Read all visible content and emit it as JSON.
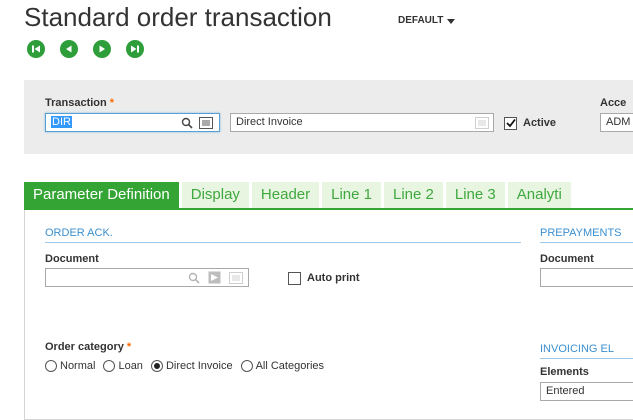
{
  "page": {
    "title": "Standard order transaction",
    "variant": "DEFAULT"
  },
  "nav": {
    "buttons": [
      "first-record-icon",
      "previous-record-icon",
      "next-record-icon",
      "last-record-icon"
    ],
    "color": "#2e9e3a"
  },
  "criteria": {
    "transaction_label": "Transaction",
    "transaction_value": "DIR",
    "transaction_description": "Direct Invoice",
    "active_label": "Active",
    "active_checked": true,
    "access_label": "Acce",
    "access_value": "ADM"
  },
  "tabs": [
    {
      "label": "Parameter Definition",
      "active": true
    },
    {
      "label": "Display",
      "active": false
    },
    {
      "label": "Header",
      "active": false
    },
    {
      "label": "Line 1",
      "active": false
    },
    {
      "label": "Line 2",
      "active": false
    },
    {
      "label": "Line 3",
      "active": false
    },
    {
      "label": "Analyti",
      "active": false
    }
  ],
  "order_ack": {
    "section_title": "ORDER ACK.",
    "document_label": "Document",
    "document_value": "",
    "auto_print_label": "Auto print",
    "auto_print_checked": false
  },
  "order_category": {
    "label": "Order category",
    "options": [
      "Normal",
      "Loan",
      "Direct Invoice",
      "All Categories"
    ],
    "selected": "Direct Invoice"
  },
  "prepayments": {
    "section_title": "PREPAYMENTS",
    "document_label": "Document",
    "document_value": ""
  },
  "invoicing": {
    "section_title": "INVOICING EL",
    "elements_label": "Elements",
    "elements_value": "Entered"
  },
  "colors": {
    "accent_green": "#34a534",
    "tab_inactive_bg": "#e8f5e1",
    "section_blue": "#3a8fd0",
    "required_orange": "#ff6a00"
  }
}
